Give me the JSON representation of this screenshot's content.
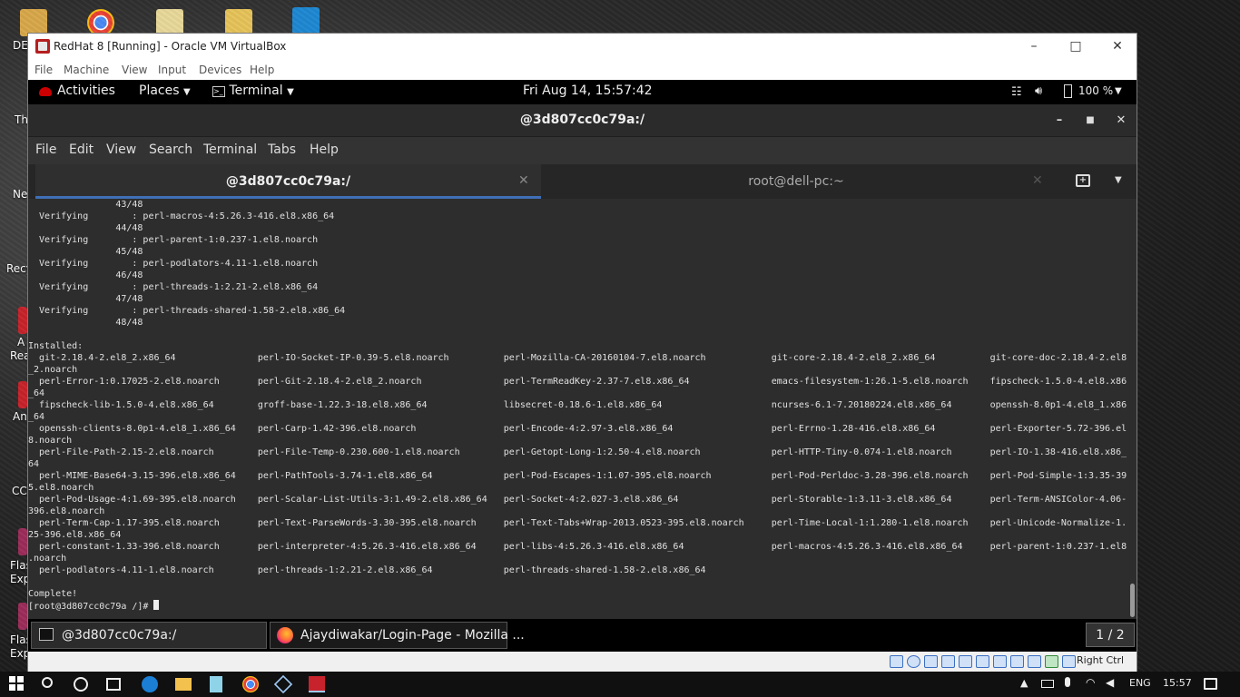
{
  "desktop": {
    "labels": [
      "DE",
      "Th",
      "Ne",
      "Recy",
      "A",
      "Rea",
      "An",
      "CC",
      "Flas",
      "Exp",
      "Flas",
      "Exp"
    ]
  },
  "vbox": {
    "title": "RedHat 8 [Running] - Oracle VM VirtualBox",
    "menu": [
      "File",
      "Machine",
      "View",
      "Input",
      "Devices",
      "Help"
    ],
    "host_key": "Right Ctrl"
  },
  "gnome": {
    "activities": "Activities",
    "places": "Places",
    "terminal_app": "Terminal",
    "clock": "Fri Aug 14, 15:57:42",
    "battery": "100 %"
  },
  "terminal": {
    "window_title": "@3d807cc0c79a:/",
    "menu": [
      "File",
      "Edit",
      "View",
      "Search",
      "Terminal",
      "Tabs",
      "Help"
    ],
    "tabs": [
      "@3d807cc0c79a:/",
      "root@dell-pc:~"
    ],
    "output": "                43/48\n  Verifying        : perl-macros-4:5.26.3-416.el8.x86_64\n                44/48\n  Verifying        : perl-parent-1:0.237-1.el8.noarch\n                45/48\n  Verifying        : perl-podlators-4.11-1.el8.noarch\n                46/48\n  Verifying        : perl-threads-1:2.21-2.el8.x86_64\n                47/48\n  Verifying        : perl-threads-shared-1.58-2.el8.x86_64\n                48/48\n\nInstalled:\n  git-2.18.4-2.el8_2.x86_64               perl-IO-Socket-IP-0.39-5.el8.noarch          perl-Mozilla-CA-20160104-7.el8.noarch            git-core-2.18.4-2.el8_2.x86_64          git-core-doc-2.18.4-2.el8\n_2.noarch\n  perl-Error-1:0.17025-2.el8.noarch       perl-Git-2.18.4-2.el8_2.noarch               perl-TermReadKey-2.37-7.el8.x86_64               emacs-filesystem-1:26.1-5.el8.noarch    fipscheck-1.5.0-4.el8.x86\n_64\n  fipscheck-lib-1.5.0-4.el8.x86_64        groff-base-1.22.3-18.el8.x86_64              libsecret-0.18.6-1.el8.x86_64                    ncurses-6.1-7.20180224.el8.x86_64       openssh-8.0p1-4.el8_1.x86\n_64\n  openssh-clients-8.0p1-4.el8_1.x86_64    perl-Carp-1.42-396.el8.noarch                perl-Encode-4:2.97-3.el8.x86_64                  perl-Errno-1.28-416.el8.x86_64          perl-Exporter-5.72-396.el\n8.noarch\n  perl-File-Path-2.15-2.el8.noarch        perl-File-Temp-0.230.600-1.el8.noarch        perl-Getopt-Long-1:2.50-4.el8.noarch             perl-HTTP-Tiny-0.074-1.el8.noarch       perl-IO-1.38-416.el8.x86_\n64\n  perl-MIME-Base64-3.15-396.el8.x86_64    perl-PathTools-3.74-1.el8.x86_64             perl-Pod-Escapes-1:1.07-395.el8.noarch           perl-Pod-Perldoc-3.28-396.el8.noarch    perl-Pod-Simple-1:3.35-39\n5.el8.noarch\n  perl-Pod-Usage-4:1.69-395.el8.noarch    perl-Scalar-List-Utils-3:1.49-2.el8.x86_64   perl-Socket-4:2.027-3.el8.x86_64                 perl-Storable-1:3.11-3.el8.x86_64       perl-Term-ANSIColor-4.06-\n396.el8.noarch\n  perl-Term-Cap-1.17-395.el8.noarch       perl-Text-ParseWords-3.30-395.el8.noarch     perl-Text-Tabs+Wrap-2013.0523-395.el8.noarch     perl-Time-Local-1:1.280-1.el8.noarch    perl-Unicode-Normalize-1.\n25-396.el8.x86_64\n  perl-constant-1.33-396.el8.noarch       perl-interpreter-4:5.26.3-416.el8.x86_64     perl-libs-4:5.26.3-416.el8.x86_64                perl-macros-4:5.26.3-416.el8.x86_64     perl-parent-1:0.237-1.el8\n.noarch\n  perl-podlators-4.11-1.el8.noarch        perl-threads-1:2.21-2.el8.x86_64             perl-threads-shared-1.58-2.el8.x86_64\n\nComplete!\n",
    "prompt": "[root@3d807cc0c79a /]# "
  },
  "guest_taskbar": {
    "items": [
      "@3d807cc0c79a:/",
      "Ajaydiwakar/Login-Page - Mozilla ..."
    ],
    "workspace": "1 / 2"
  },
  "win_tray": {
    "lang": "ENG",
    "time": "15:57"
  }
}
